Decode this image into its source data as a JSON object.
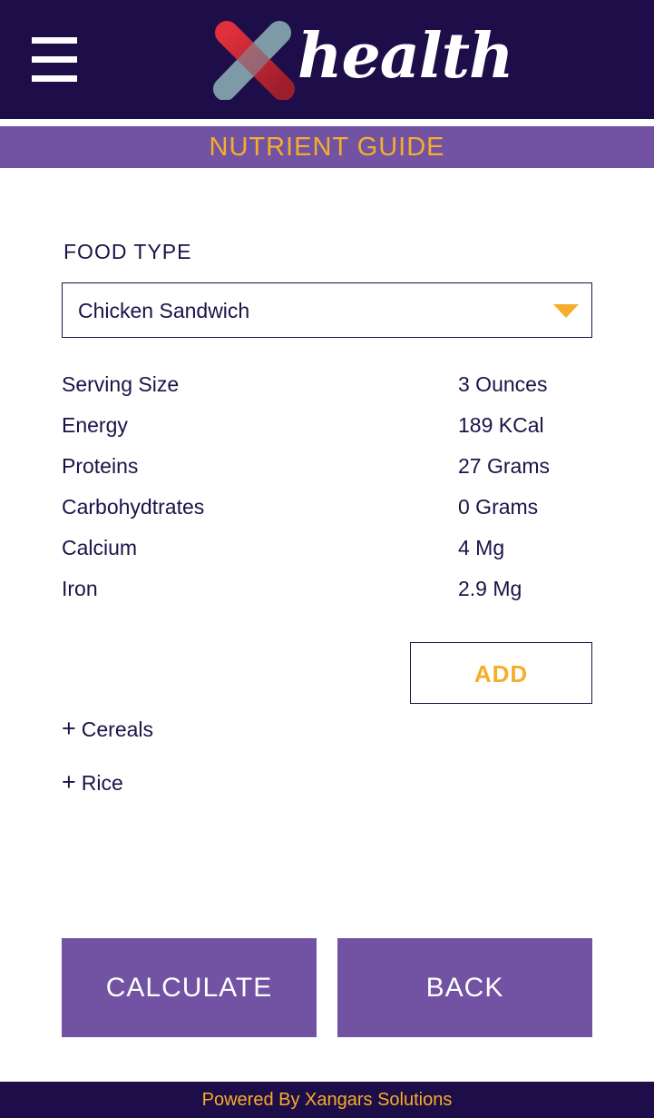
{
  "header": {
    "menu_icon": "hamburger-menu-icon",
    "logo_text": "health"
  },
  "title_bar": {
    "title": "NUTRIENT GUIDE"
  },
  "form": {
    "food_type_label": "FOOD TYPE",
    "food_type_value": "Chicken Sandwich",
    "dropdown_icon": "triangle-down-icon"
  },
  "nutrients": [
    {
      "name": "Serving Size",
      "value": "3 Ounces"
    },
    {
      "name": "Energy",
      "value": "189 KCal"
    },
    {
      "name": "Proteins",
      "value": "27 Grams"
    },
    {
      "name": "Carbohydtrates",
      "value": "0 Grams"
    },
    {
      "name": "Calcium",
      "value": "4 Mg"
    },
    {
      "name": "Iron",
      "value": "2.9 Mg"
    }
  ],
  "add_label": "ADD",
  "categories": [
    {
      "icon": "+",
      "label": "Cereals"
    },
    {
      "icon": "+",
      "label": "Rice"
    }
  ],
  "buttons": {
    "calculate": "CALCULATE",
    "back": "BACK"
  },
  "footer": {
    "text": "Powered By Xangars Solutions"
  },
  "colors": {
    "header_bg": "#1d0d48",
    "accent_purple": "#7253a3",
    "accent_orange": "#f5ad2a",
    "logo_red": "#c62836",
    "logo_slate": "#7d9aa6"
  }
}
